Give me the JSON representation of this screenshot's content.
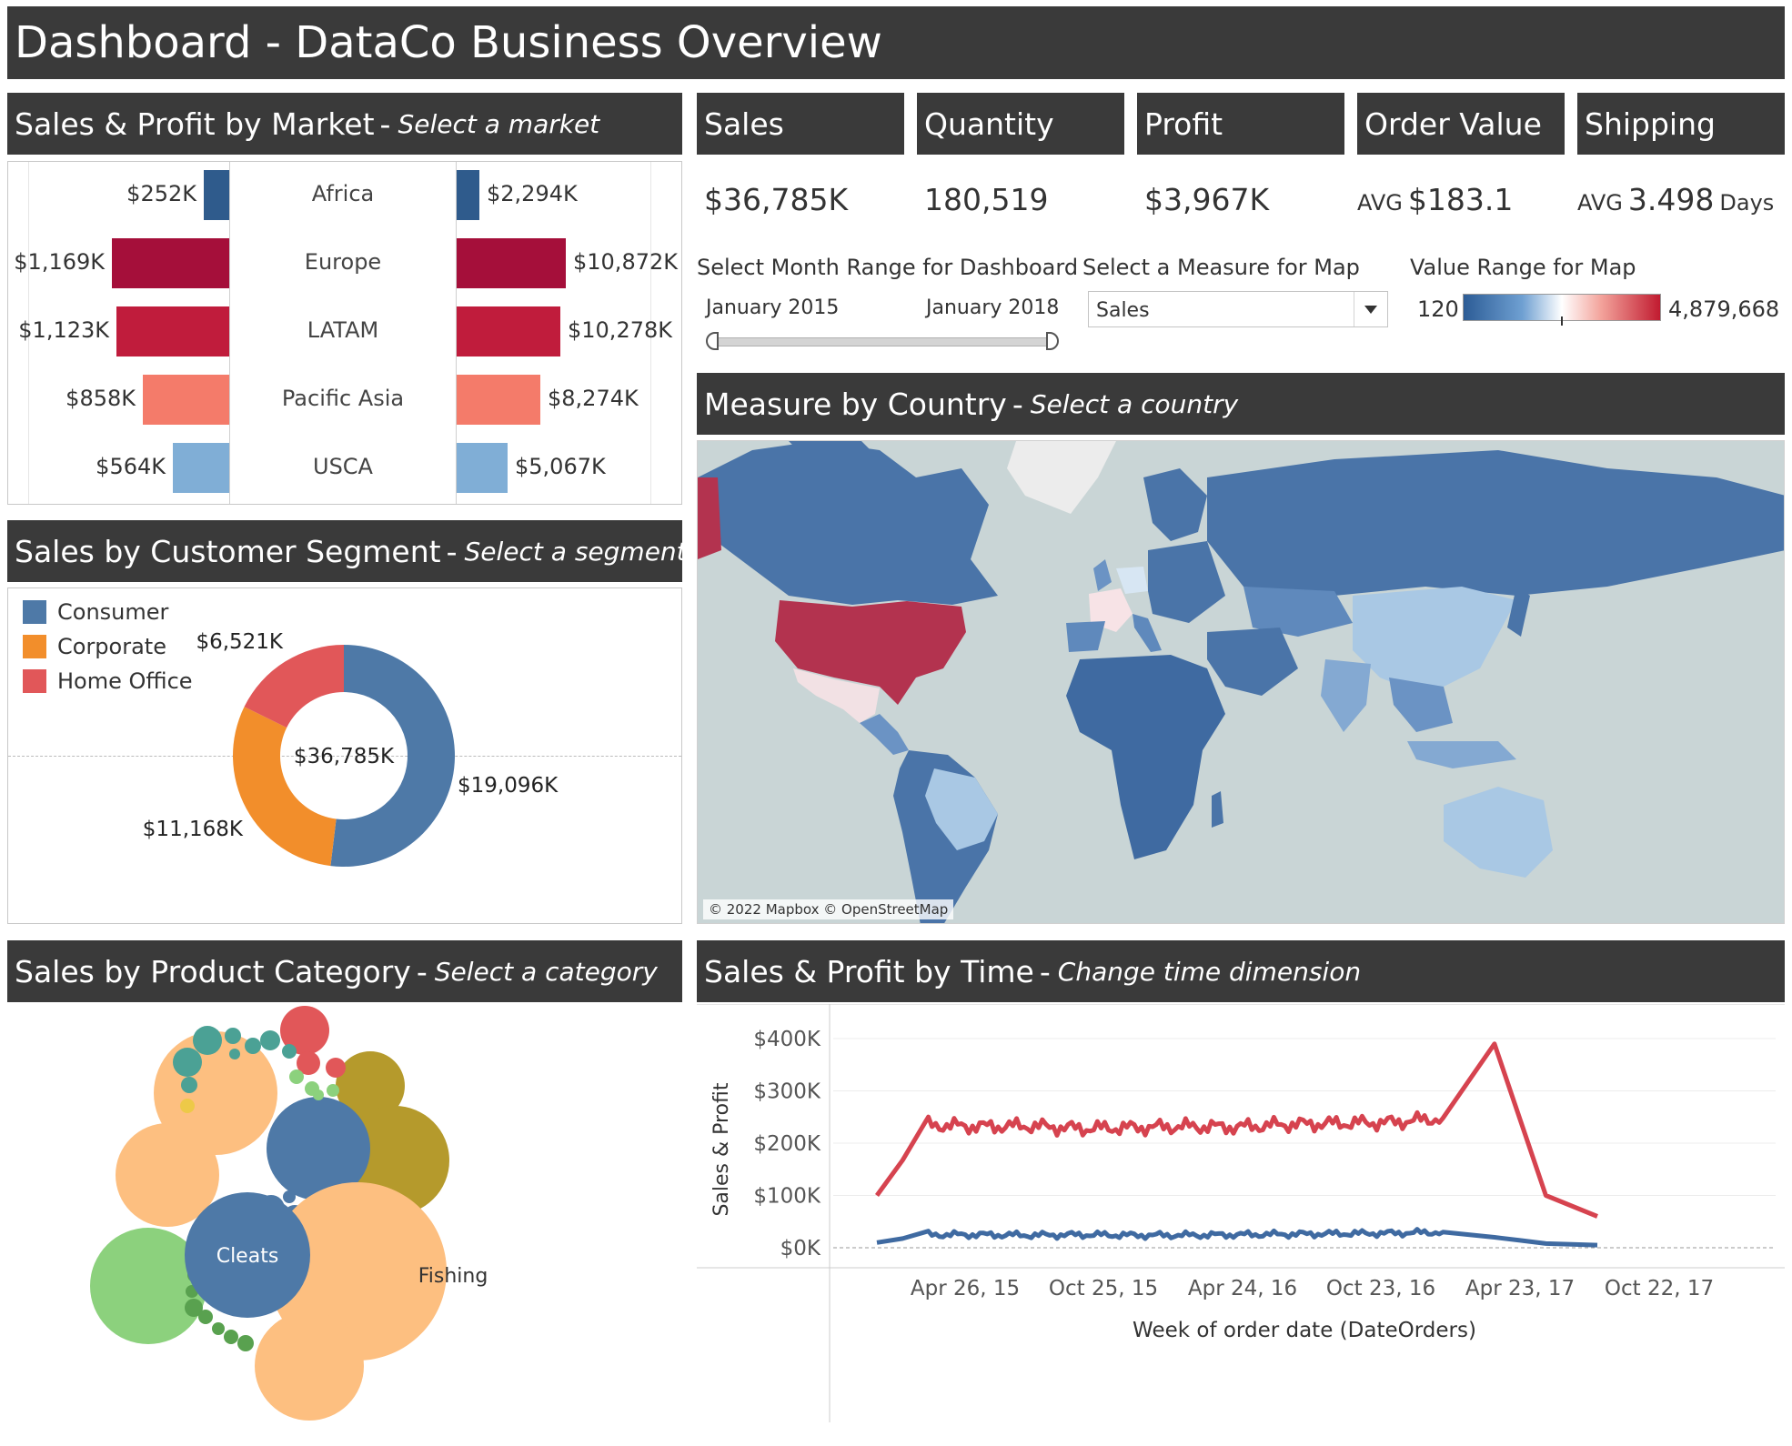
{
  "page_title": "Dashboard - DataCo Business Overview",
  "market_panel": {
    "title": "Sales & Profit by Market",
    "hint": "Select a market",
    "rows": [
      {
        "market": "Africa",
        "profit": 252,
        "profit_label": "$252K",
        "sales": 2294,
        "sales_label": "$2,294K",
        "color": "#2f5b8c"
      },
      {
        "market": "Europe",
        "profit": 1169,
        "profit_label": "$1,169K",
        "sales": 10872,
        "sales_label": "$10,872K",
        "color": "#a50f3a"
      },
      {
        "market": "LATAM",
        "profit": 1123,
        "profit_label": "$1,123K",
        "sales": 10278,
        "sales_label": "$10,278K",
        "color": "#c01c3c"
      },
      {
        "market": "Pacific Asia",
        "profit": 858,
        "profit_label": "$858K",
        "sales": 8274,
        "sales_label": "$8,274K",
        "color": "#f47b6a"
      },
      {
        "market": "USCA",
        "profit": 564,
        "profit_label": "$564K",
        "sales": 5067,
        "sales_label": "$5,067K",
        "color": "#80aed6"
      }
    ]
  },
  "kpis": [
    {
      "label": "Sales",
      "prefix": "",
      "value": "$36,785K",
      "suffix": ""
    },
    {
      "label": "Quantity",
      "prefix": "",
      "value": "180,519",
      "suffix": ""
    },
    {
      "label": "Profit",
      "prefix": "",
      "value": "$3,967K",
      "suffix": ""
    },
    {
      "label": "Order Value",
      "prefix": "AVG",
      "value": "$183.1",
      "suffix": ""
    },
    {
      "label": "Shipping",
      "prefix": "AVG",
      "value": "3.498",
      "suffix": "Days"
    }
  ],
  "controls": {
    "month_range": {
      "title": "Select Month Range for Dashboard",
      "start": "January 2015",
      "end": "January 2018"
    },
    "measure": {
      "title": "Select a Measure for Map",
      "value": "Sales"
    },
    "value_range": {
      "title": "Value Range for Map",
      "min": "120",
      "max": "4,879,668"
    }
  },
  "segment_panel": {
    "title": "Sales by Customer Segment",
    "hint": "Select a segment",
    "center_label": "$36,785K",
    "segments": [
      {
        "name": "Consumer",
        "value": 19096,
        "label": "$19,096K",
        "color": "#4e79a7"
      },
      {
        "name": "Corporate",
        "value": 11168,
        "label": "$11,168K",
        "color": "#f28e2b"
      },
      {
        "name": "Home Office",
        "value": 6521,
        "label": "$6,521K",
        "color": "#e15759"
      }
    ]
  },
  "map_panel": {
    "title": "Measure by Country",
    "hint": "Select a country",
    "attribution": "© 2022 Mapbox © OpenStreetMap"
  },
  "category_panel": {
    "title": "Sales by Product Category",
    "hint": "Select a category",
    "labels": [
      "Cleats",
      "Fishing"
    ]
  },
  "time_panel": {
    "title": "Sales & Profit by Time",
    "hint": "Change time dimension",
    "ylabel": "Sales & Profit",
    "xlabel": "Week of order date (DateOrders)",
    "y_ticks": [
      "$400K",
      "$300K",
      "$200K",
      "$100K",
      "$0K"
    ],
    "x_ticks": [
      "Apr 26, 15",
      "Oct 25, 15",
      "Apr 24, 16",
      "Oct 23, 16",
      "Apr 23, 17",
      "Oct 22, 17"
    ]
  },
  "chart_data": [
    {
      "type": "bar",
      "title": "Sales & Profit by Market",
      "categories": [
        "Africa",
        "Europe",
        "LATAM",
        "Pacific Asia",
        "USCA"
      ],
      "series": [
        {
          "name": "Profit",
          "values": [
            252,
            1169,
            1123,
            858,
            564
          ]
        },
        {
          "name": "Sales",
          "values": [
            2294,
            10872,
            10278,
            8274,
            5067
          ]
        }
      ],
      "unit": "$K"
    },
    {
      "type": "pie",
      "title": "Sales by Customer Segment",
      "categories": [
        "Consumer",
        "Corporate",
        "Home Office"
      ],
      "values": [
        19096,
        11168,
        6521
      ],
      "unit": "$K"
    },
    {
      "type": "line",
      "title": "Sales & Profit by Time",
      "xlabel": "Week of order date (DateOrders)",
      "ylabel": "Sales & Profit",
      "ylim": [
        0,
        400000
      ],
      "x": [
        "2015-01",
        "2015-04",
        "2015-07",
        "2015-10",
        "2016-01",
        "2016-04",
        "2016-07",
        "2016-10",
        "2017-01",
        "2017-04",
        "2017-07",
        "2017-10",
        "2017-11",
        "2017-12",
        "2018-01"
      ],
      "series": [
        {
          "values": [
            100000,
            235000,
            232000,
            233000,
            228000,
            230000,
            232000,
            231000,
            236000,
            238000,
            240000,
            248000,
            390000,
            100000,
            60000
          ]
        },
        {
          "values": [
            10000,
            25000,
            25000,
            24000,
            25000,
            24000,
            24000,
            25000,
            26000,
            27000,
            28000,
            30000,
            20000,
            8000,
            5000
          ]
        }
      ]
    }
  ]
}
